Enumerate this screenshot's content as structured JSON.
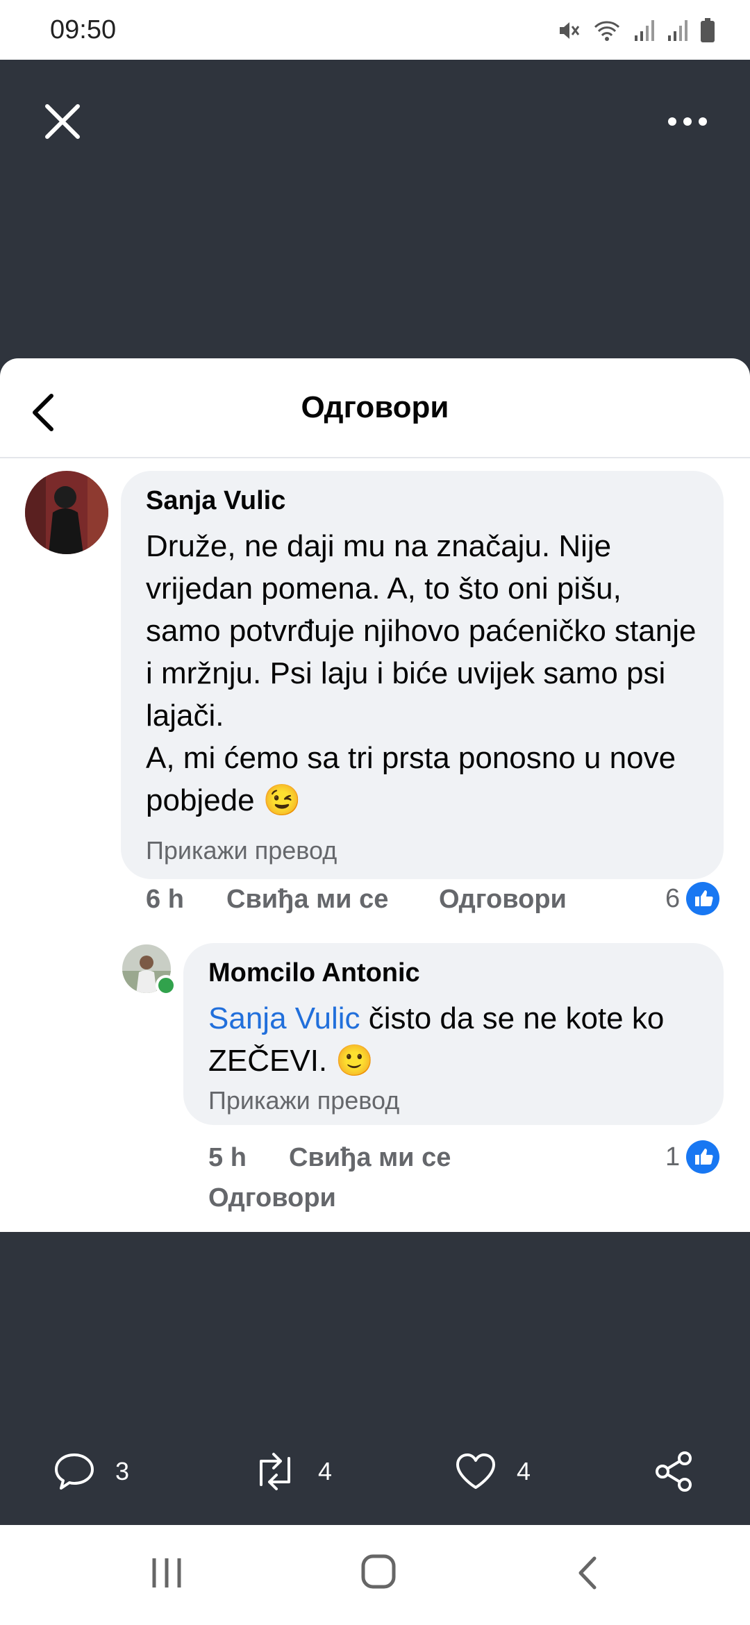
{
  "status_bar": {
    "time": "09:50"
  },
  "reply_sheet": {
    "title": "Одговори",
    "comments": [
      {
        "author": "Sanja Vulic",
        "text": "Druže, ne daji mu na značaju. Nije vrijedan pomena. A, to što oni pišu, samo potvrđuje njihovo paćeničko stanje i mržnju. Psi laju i biće uvijek samo psi lajači.\nA, mi ćemo sa tri prsta ponosno u nove pobjede",
        "emoji": "😉",
        "translate": "Прикажи превод",
        "time": "6 h",
        "like_label": "Свиђа ми се",
        "reply_label": "Одговори",
        "reactions": "6"
      },
      {
        "author": "Momcilo Antonic",
        "mention": "Sanja Vulic",
        "text": " čisto da se ne kote ko ZEČEVI. ",
        "emoji": "🙂",
        "translate": "Прикажи превод",
        "time": "5 h",
        "like_label": "Свиђа ми се",
        "reply_label": "Одговори",
        "reactions": "1"
      }
    ]
  },
  "actions": {
    "replies": "3",
    "retweets": "4",
    "likes": "4"
  },
  "icons": [
    "close-icon",
    "more-icon",
    "back-icon",
    "like-icon",
    "comment-icon",
    "retweet-icon",
    "heart-icon",
    "share-icon",
    "recent-apps-icon",
    "home-icon",
    "back-nav-icon"
  ],
  "colors": {
    "dark_bg": "#2f343d",
    "facebook_blue": "#1877f2",
    "mention_blue": "#216fdb",
    "bubble": "#f0f2f5"
  }
}
